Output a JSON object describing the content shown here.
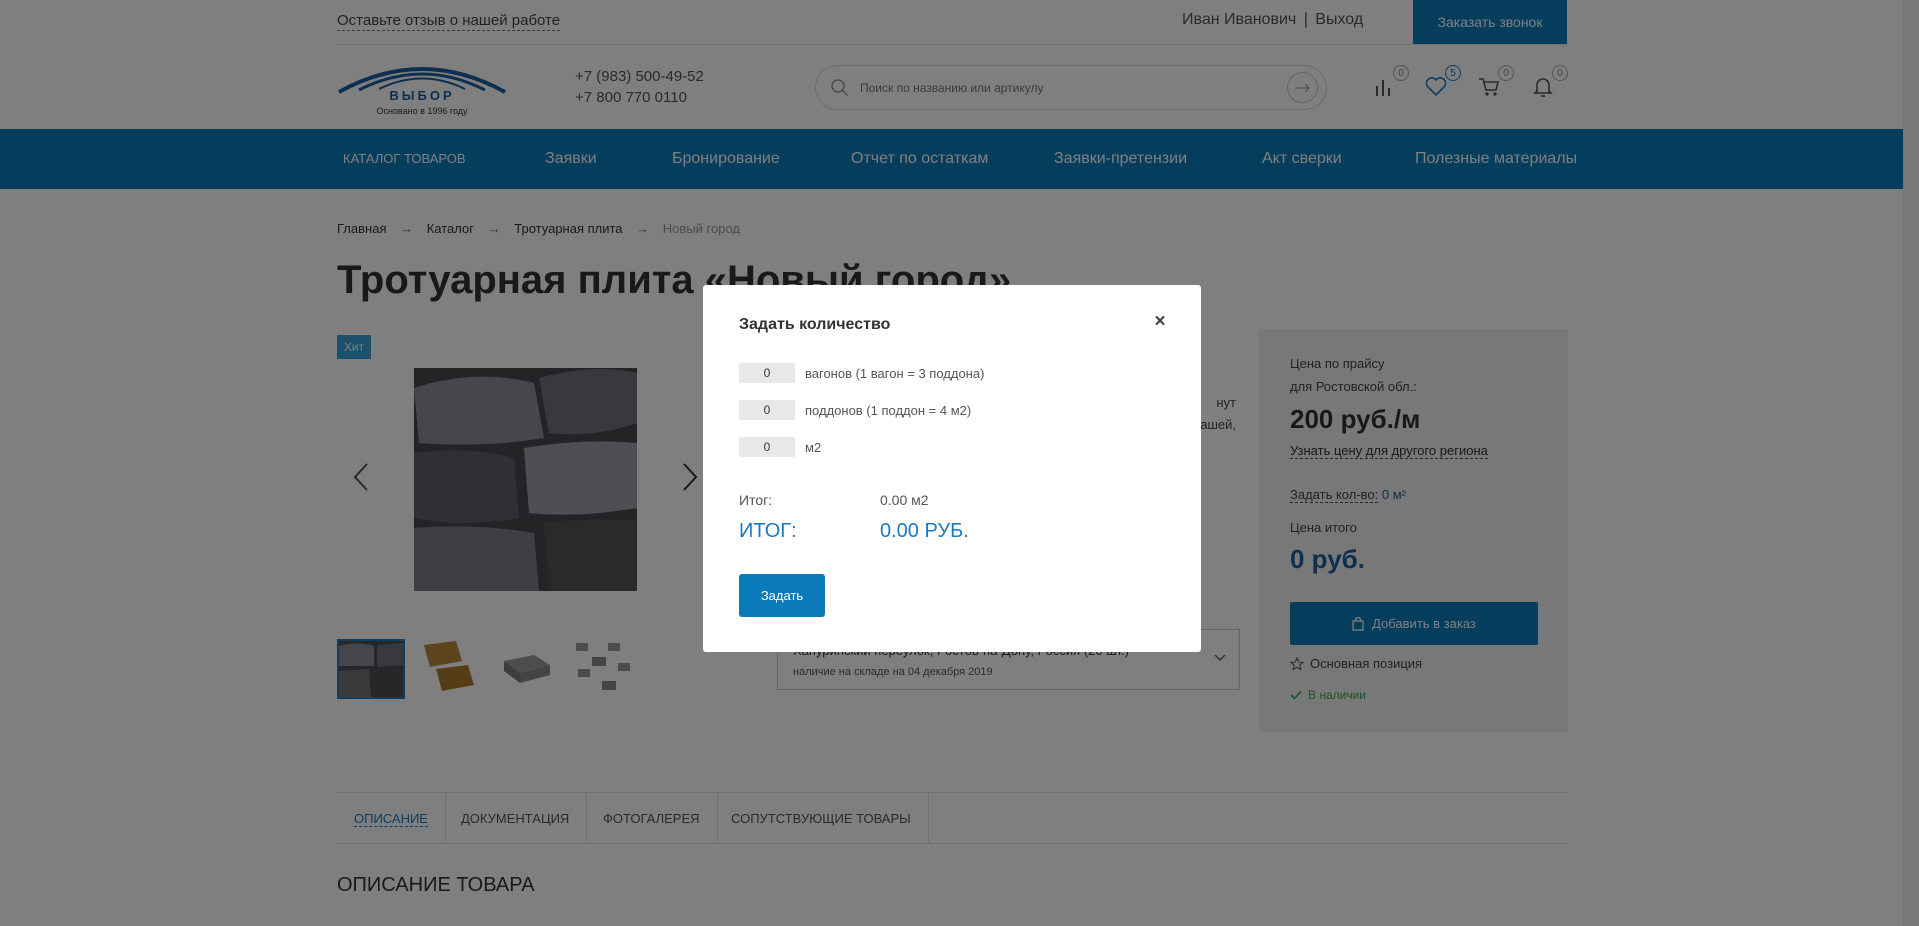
{
  "topbar": {
    "feedback_link": "Оставьте отзыв о нашей работе",
    "user_name": "Иван Иванович",
    "user_separator": "|",
    "logout": "Выход",
    "callback_button": "Заказать звонок"
  },
  "header": {
    "logo_text": "ВЫБОР",
    "logo_subtitle": "Основано в 1996 году",
    "phone_1": "+7 (983) 500-49-52",
    "phone_2": "+7 800 770 0110",
    "search_placeholder": "Поиск по названию или артикулу",
    "icons": [
      {
        "name": "compare-icon",
        "count": "0"
      },
      {
        "name": "heart-icon",
        "count": "5"
      },
      {
        "name": "cart-icon",
        "count": "0"
      },
      {
        "name": "bell-icon",
        "count": "0"
      }
    ]
  },
  "nav": {
    "items": [
      "КАТАЛОГ ТОВАРОВ",
      "Заявки",
      "Бронирование",
      "Отчет по остаткам",
      "Заявки-претензии",
      "Акт сверки",
      "Полезные материалы"
    ]
  },
  "breadcrumb": {
    "items": [
      "Главная",
      "Каталог",
      "Тротуарная плита"
    ],
    "separator": "→",
    "current": "Новый город"
  },
  "product": {
    "title": "Тротуарная плита «Новый город»",
    "badge": "Хит",
    "desc_fragment_1": "нут",
    "desc_fragment_2": "ашей,",
    "store_name": "Хапуринский переулок, Ростов-на-Дону, Россия (20 шт.)",
    "store_note": "наличие на складе на 04 декабря 2019"
  },
  "price_card": {
    "price_label_1": "Цена по прайсу",
    "price_label_2": "для Ростовской обл.:",
    "price_value": "200 руб./м",
    "other_region_link": "Узнать цену для другого региона",
    "qty_link": "Задать кол-во:",
    "qty_value": "0 м²",
    "total_label": "Цена итого",
    "total_value": "0 руб.",
    "add_button": "Добавить в заказ",
    "favorite_label": "Основная позиция",
    "stock_label": "В наличии"
  },
  "tabs": {
    "items": [
      "ОПИСАНИЕ",
      "ДОКУМЕНТАЦИЯ",
      "ФОТОГАЛЕРЕЯ",
      "СОПУТСТВУЮЩИЕ ТОВАРЫ"
    ],
    "section_title": "ОПИСАНИЕ ТОВАРА"
  },
  "modal": {
    "title": "Задать количество",
    "close": "×",
    "rows": [
      {
        "value": "0",
        "label": "вагонов (1 вагон = 3 поддона)"
      },
      {
        "value": "0",
        "label": "поддонов (1 поддон = 4 м2)"
      },
      {
        "value": "0",
        "label": "м2"
      }
    ],
    "sum_label": "Итог:",
    "sum_value": "0.00 м2",
    "total_label": "ИТОГ:",
    "total_value": "0.00 РУБ.",
    "submit_button": "Задать"
  },
  "colors": {
    "accent": "#0b7ab9",
    "accent_text": "#1a7ac4",
    "badge": "#38a3dc",
    "stock": "#3aa84a",
    "overlay": "rgba(0,0,0,0.5)"
  }
}
